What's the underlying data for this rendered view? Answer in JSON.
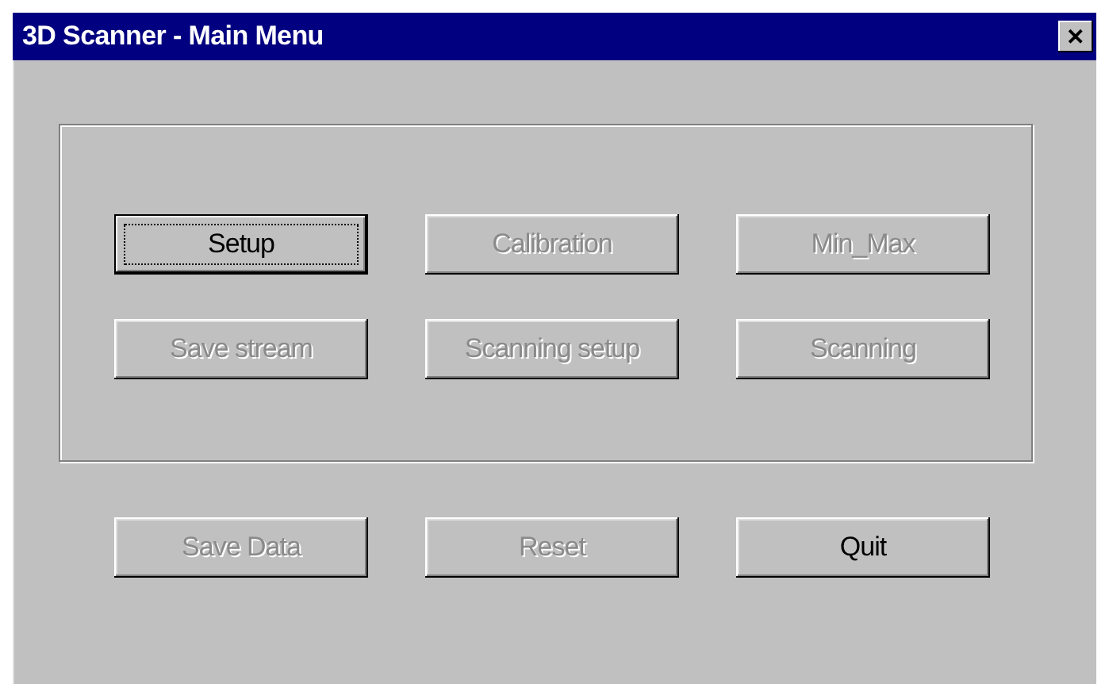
{
  "window": {
    "title": "3D Scanner - Main Menu",
    "close_glyph": "✕"
  },
  "group_buttons": [
    {
      "label": "Setup",
      "disabled": false,
      "focused": true
    },
    {
      "label": "Calibration",
      "disabled": true,
      "focused": false
    },
    {
      "label": "Min_Max",
      "disabled": true,
      "focused": false
    },
    {
      "label": "Save stream",
      "disabled": true,
      "focused": false
    },
    {
      "label": "Scanning setup",
      "disabled": true,
      "focused": false
    },
    {
      "label": "Scanning",
      "disabled": true,
      "focused": false
    }
  ],
  "bottom_buttons": [
    {
      "label": "Save Data",
      "disabled": true,
      "focused": false
    },
    {
      "label": "Reset",
      "disabled": true,
      "focused": false
    },
    {
      "label": "Quit",
      "disabled": false,
      "focused": false
    }
  ]
}
